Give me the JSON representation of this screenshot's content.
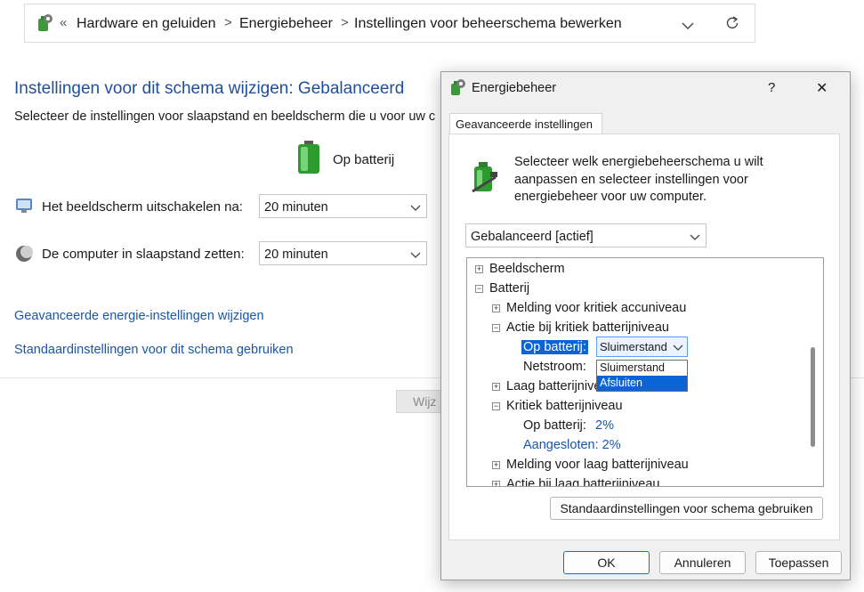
{
  "breadcrumb": {
    "overflow": "«",
    "items": [
      "Hardware en geluiden",
      "Energiebeheer",
      "Instellingen voor beheerschema bewerken"
    ],
    "separator": ">"
  },
  "main": {
    "title": "Instellingen voor dit schema wijzigen: Gebalanceerd",
    "subtitle": "Selecteer de instellingen voor slaapstand en beeldscherm die u voor uw c",
    "column_header": "Op batterij",
    "settings": [
      {
        "label": "Het beeldscherm uitschakelen na:",
        "value": "20 minuten",
        "icon": "display-icon"
      },
      {
        "label": "De computer in slaapstand zetten:",
        "value": "20 minuten",
        "icon": "moon-icon"
      }
    ],
    "links": [
      "Geavanceerde energie-instellingen wijzigen",
      "Standaardinstellingen voor dit schema gebruiken"
    ],
    "partial_button": "Wijz"
  },
  "dialog": {
    "title": "Energiebeheer",
    "help": "?",
    "close": "✕",
    "tab": "Geavanceerde instellingen",
    "description": "Selecteer welk energiebeheerschema u wilt aanpassen en selecteer instellingen voor energiebeheer voor uw computer.",
    "plan_select": "Gebalanceerd [actief]",
    "tree": {
      "beeldscherm": "Beeldscherm",
      "batterij": "Batterij",
      "melding_kritiek": "Melding voor kritiek accuniveau",
      "actie_kritiek": "Actie bij kritiek batterijniveau",
      "op_batterij_label": "Op batterij:",
      "op_batterij_value": "Sluimerstand",
      "netstroom_label": "Netstroom:",
      "laag_niveau": "Laag batterijniveau",
      "kritiek_niveau": "Kritiek batterijniveau",
      "kritiek_op_batterij_label": "Op batterij:",
      "kritiek_op_batterij_value": "2%",
      "kritiek_aangesloten": "Aangesloten: 2%",
      "melding_laag": "Melding voor laag batterijniveau",
      "actie_laag": "Actie bij laag batterijniveau"
    },
    "dropdown_options": [
      "Sluimerstand",
      "Afsluiten"
    ],
    "restore_button": "Standaardinstellingen voor schema gebruiken",
    "ok": "OK",
    "cancel": "Annuleren",
    "apply": "Toepassen"
  },
  "colors": {
    "accent": "#0a64d6",
    "link": "#1a56a8",
    "title": "#1f4e9a"
  }
}
